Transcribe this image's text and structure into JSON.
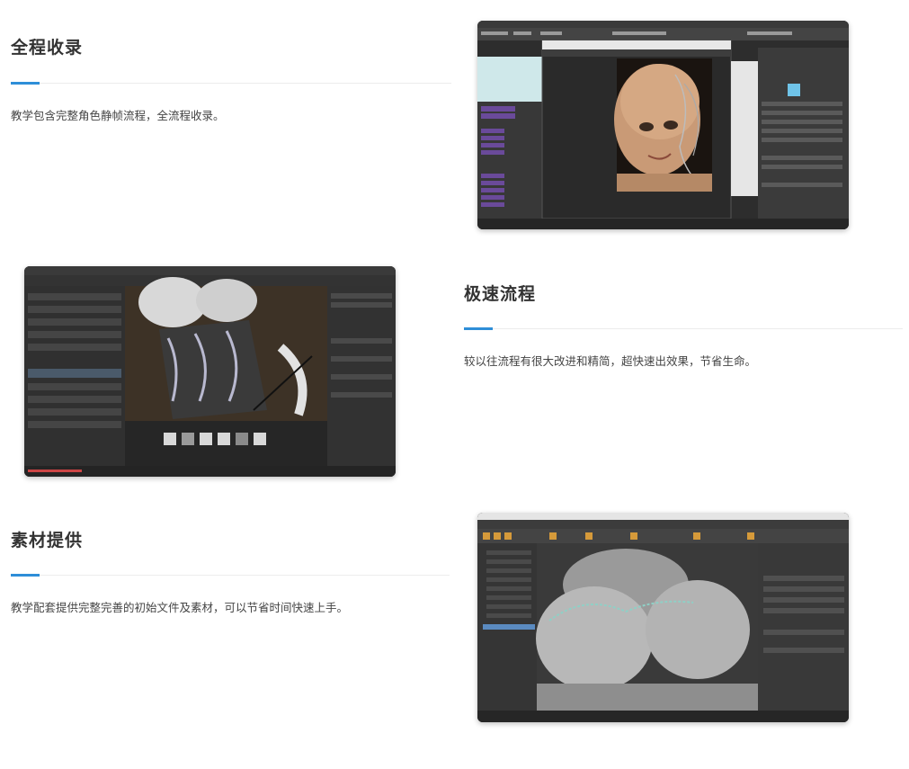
{
  "features": [
    {
      "title": "全程收录",
      "description": "教学包含完整角色静帧流程，全流程收录。"
    },
    {
      "title": "极速流程",
      "description": "较以往流程有很大改进和精简，超快速出效果，节省生命。"
    },
    {
      "title": "素材提供",
      "description": "教学配套提供完整完善的初始文件及素材，可以节省时间快速上手。"
    }
  ],
  "colors": {
    "accent": "#2e8ed8",
    "rule": "#ececec"
  },
  "screenshots": [
    {
      "name": "maya-head-render-screenshot"
    },
    {
      "name": "substance-corset-texturing-screenshot"
    },
    {
      "name": "maya-torso-sculpt-screenshot"
    }
  ]
}
